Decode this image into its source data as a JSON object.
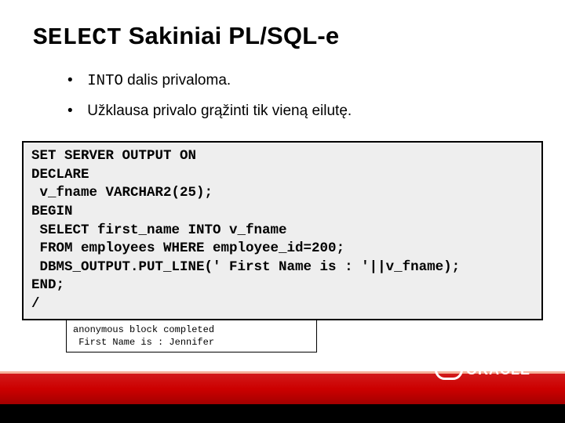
{
  "title": {
    "mono": "SELECT",
    "rest": " Sakiniai PL/SQL-e"
  },
  "bullets": [
    {
      "mono": "INTO",
      "text": " dalis privaloma."
    },
    {
      "mono": "",
      "text": "Užklausa privalo grąžinti tik vieną eilutę."
    }
  ],
  "code": "SET SERVER OUTPUT ON\nDECLARE\n v_fname VARCHAR2(25);\nBEGIN\n SELECT first_name INTO v_fname\n FROM employees WHERE employee_id=200;\n DBMS_OUTPUT.PUT_LINE(' First Name is : '||v_fname);\nEND;\n/",
  "output": "anonymous block completed\n First Name is : Jennifer",
  "logo": "ORACLE"
}
